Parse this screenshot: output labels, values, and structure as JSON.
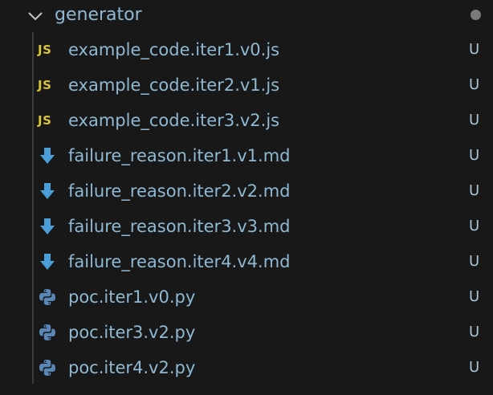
{
  "folder": {
    "name": "generator",
    "icon": "chevron-down-icon"
  },
  "files": [
    {
      "name": "example_code.iter1.v0.js",
      "type": "js",
      "icon_text": "JS",
      "status": "U"
    },
    {
      "name": "example_code.iter2.v1.js",
      "type": "js",
      "icon_text": "JS",
      "status": "U"
    },
    {
      "name": "example_code.iter3.v2.js",
      "type": "js",
      "icon_text": "JS",
      "status": "U"
    },
    {
      "name": "failure_reason.iter1.v1.md",
      "type": "md",
      "status": "U"
    },
    {
      "name": "failure_reason.iter2.v2.md",
      "type": "md",
      "status": "U"
    },
    {
      "name": "failure_reason.iter3.v3.md",
      "type": "md",
      "status": "U"
    },
    {
      "name": "failure_reason.iter4.v4.md",
      "type": "md",
      "status": "U"
    },
    {
      "name": "poc.iter1.v0.py",
      "type": "py",
      "status": "U"
    },
    {
      "name": "poc.iter3.v2.py",
      "type": "py",
      "status": "U"
    },
    {
      "name": "poc.iter4.v2.py",
      "type": "py",
      "status": "U"
    }
  ],
  "colors": {
    "background": "#181818",
    "text": "#8fb9d3",
    "js_icon": "#d7c33e",
    "md_icon": "#4a9fd8",
    "py_icon": "#5b87b8",
    "status": "#a8c3d3"
  }
}
